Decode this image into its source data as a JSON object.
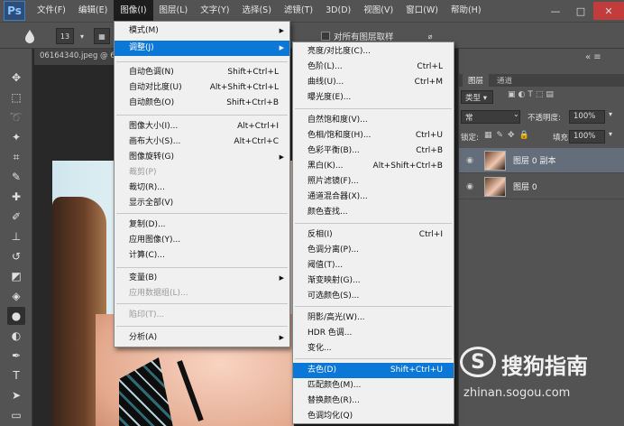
{
  "app": {
    "logo": "Ps"
  },
  "menubar": {
    "items": [
      "文件(F)",
      "编辑(E)",
      "图像(I)",
      "图层(L)",
      "文字(Y)",
      "选择(S)",
      "滤镜(T)",
      "3D(D)",
      "视图(V)",
      "窗口(W)",
      "帮助(H)"
    ],
    "active_index": 2
  },
  "window_controls": {
    "minimize": "—",
    "maximize": "□",
    "close": "✕"
  },
  "options_bar": {
    "brush_size": "13",
    "sample_all_layers": "对所有图层取样"
  },
  "document": {
    "tab_label": "06164340.jpeg @ 6"
  },
  "image_menu": {
    "items": [
      {
        "label": "模式(M)",
        "shortcut": "",
        "submenu": true,
        "disabled": false
      },
      {
        "label": "调整(J)",
        "shortcut": "",
        "submenu": true,
        "disabled": false,
        "highlighted": true
      },
      {
        "label": "自动色调(N)",
        "shortcut": "Shift+Ctrl+L",
        "submenu": false,
        "disabled": false
      },
      {
        "label": "自动对比度(U)",
        "shortcut": "Alt+Shift+Ctrl+L",
        "submenu": false,
        "disabled": false
      },
      {
        "label": "自动颜色(O)",
        "shortcut": "Shift+Ctrl+B",
        "submenu": false,
        "disabled": false
      },
      {
        "label": "图像大小(I)...",
        "shortcut": "Alt+Ctrl+I",
        "submenu": false,
        "disabled": false
      },
      {
        "label": "画布大小(S)...",
        "shortcut": "Alt+Ctrl+C",
        "submenu": false,
        "disabled": false
      },
      {
        "label": "图像旋转(G)",
        "shortcut": "",
        "submenu": true,
        "disabled": false
      },
      {
        "label": "裁剪(P)",
        "shortcut": "",
        "submenu": false,
        "disabled": true
      },
      {
        "label": "裁切(R)...",
        "shortcut": "",
        "submenu": false,
        "disabled": false
      },
      {
        "label": "显示全部(V)",
        "shortcut": "",
        "submenu": false,
        "disabled": false
      },
      {
        "label": "复制(D)...",
        "shortcut": "",
        "submenu": false,
        "disabled": false
      },
      {
        "label": "应用图像(Y)...",
        "shortcut": "",
        "submenu": false,
        "disabled": false
      },
      {
        "label": "计算(C)...",
        "shortcut": "",
        "submenu": false,
        "disabled": false
      },
      {
        "label": "变量(B)",
        "shortcut": "",
        "submenu": true,
        "disabled": false
      },
      {
        "label": "应用数据组(L)...",
        "shortcut": "",
        "submenu": false,
        "disabled": true
      },
      {
        "label": "陷印(T)...",
        "shortcut": "",
        "submenu": false,
        "disabled": true
      },
      {
        "label": "分析(A)",
        "shortcut": "",
        "submenu": true,
        "disabled": false
      }
    ]
  },
  "adjust_menu": {
    "items": [
      {
        "label": "亮度/对比度(C)...",
        "shortcut": ""
      },
      {
        "label": "色阶(L)...",
        "shortcut": "Ctrl+L"
      },
      {
        "label": "曲线(U)...",
        "shortcut": "Ctrl+M"
      },
      {
        "label": "曝光度(E)...",
        "shortcut": ""
      },
      {
        "label": "自然饱和度(V)...",
        "shortcut": ""
      },
      {
        "label": "色相/饱和度(H)...",
        "shortcut": "Ctrl+U"
      },
      {
        "label": "色彩平衡(B)...",
        "shortcut": "Ctrl+B"
      },
      {
        "label": "黑白(K)...",
        "shortcut": "Alt+Shift+Ctrl+B"
      },
      {
        "label": "照片滤镜(F)...",
        "shortcut": ""
      },
      {
        "label": "通道混合器(X)...",
        "shortcut": ""
      },
      {
        "label": "颜色查找...",
        "shortcut": ""
      },
      {
        "label": "反相(I)",
        "shortcut": "Ctrl+I"
      },
      {
        "label": "色调分离(P)...",
        "shortcut": ""
      },
      {
        "label": "阈值(T)...",
        "shortcut": ""
      },
      {
        "label": "渐变映射(G)...",
        "shortcut": ""
      },
      {
        "label": "可选颜色(S)...",
        "shortcut": ""
      },
      {
        "label": "阴影/高光(W)...",
        "shortcut": ""
      },
      {
        "label": "HDR 色调...",
        "shortcut": ""
      },
      {
        "label": "变化...",
        "shortcut": ""
      },
      {
        "label": "去色(D)",
        "shortcut": "Shift+Ctrl+U",
        "highlighted": true
      },
      {
        "label": "匹配颜色(M)...",
        "shortcut": ""
      },
      {
        "label": "替换颜色(R)...",
        "shortcut": ""
      },
      {
        "label": "色调均化(Q)",
        "shortcut": ""
      }
    ]
  },
  "layers_panel": {
    "tabs": [
      "图层",
      "通道"
    ],
    "filter_kind": "类型",
    "blend_mode": "常",
    "opacity_label": "不透明度:",
    "opacity_value": "100%",
    "lock_label": "锁定:",
    "fill_label": "填充:",
    "fill_value": "100%",
    "layers": [
      {
        "name": "图层 0 副本",
        "selected": true
      },
      {
        "name": "图层 0",
        "selected": false
      }
    ]
  },
  "watermark": {
    "symbol": "S",
    "brand": "搜狗指南",
    "url": "zhinan.sogou.com"
  }
}
